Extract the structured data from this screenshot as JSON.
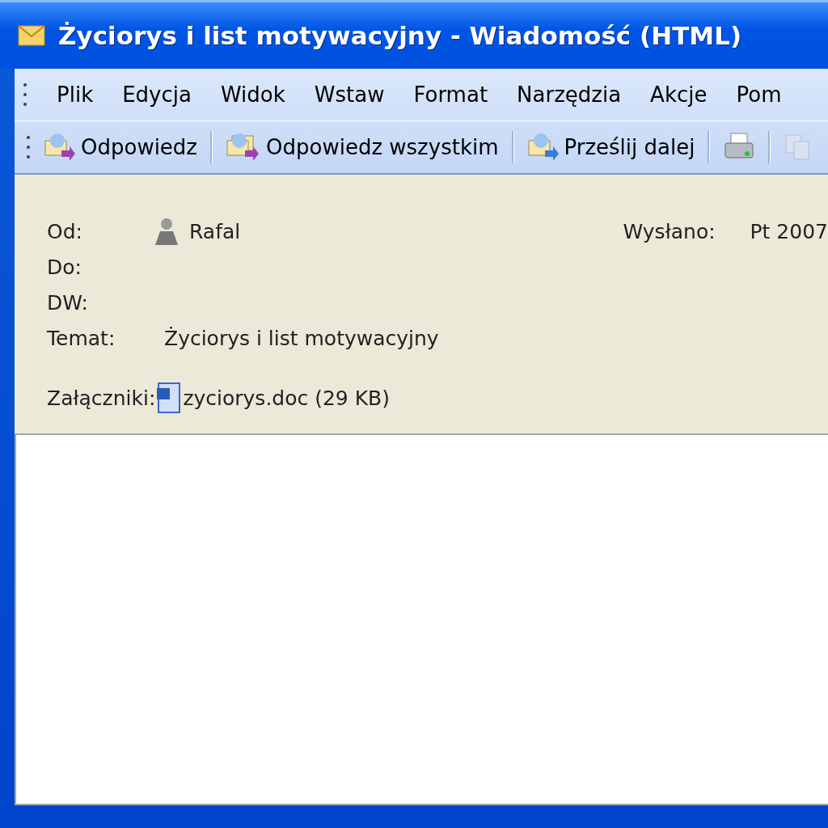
{
  "window": {
    "title": "Życiorys i list motywacyjny - Wiadomość (HTML)"
  },
  "menu": [
    "Plik",
    "Edycja",
    "Widok",
    "Wstaw",
    "Format",
    "Narzędzia",
    "Akcje",
    "Pom"
  ],
  "toolbar": [
    {
      "kind": "reply",
      "label": "Odpowiedz"
    },
    {
      "kind": "reply_all",
      "label": "Odpowiedz wszystkim"
    },
    {
      "kind": "forward",
      "label": "Prześlij dalej"
    },
    {
      "kind": "print"
    },
    {
      "kind": "copy",
      "disabled": true
    }
  ],
  "header": {
    "from_label": "Od:",
    "from": "Rafal",
    "sent_label": "Wysłano:",
    "sent": "Pt 2007",
    "to_label": "Do:",
    "cc_label": "DW:",
    "subject_label": "Temat:",
    "subject": "Życiorys i list motywacyjny",
    "attachments_label": "Załączniki:",
    "attachment": "zyciorys.doc (29 KB)"
  }
}
